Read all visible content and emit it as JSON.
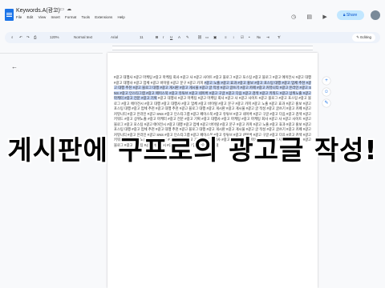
{
  "window": {
    "doc_title": "Keywords.A(광고)"
  },
  "menu": [
    "File",
    "Edit",
    "View",
    "Insert",
    "Format",
    "Tools",
    "Extensions",
    "Help"
  ],
  "header": {
    "share_label": "Share"
  },
  "toolbar": {
    "zoom": "120%",
    "style": "Normal text",
    "font": "Arial",
    "font_size": "11",
    "mode": "Editing"
  },
  "document": {
    "para_1": "#광고 대행사 #광고 마케팅 #광고 마케팅 회사 #광고 사 #광고 사이트 #광고 블로그 #광고 포스팅 #광고 블로그 #광고 에이전시 #광고 대행 #광고 대행사 #광고 업체 #광고 바이럴 #광고 문구 #광고 카피",
    "para_2": "#광고 노출 #광고 효과 #광고 홍보 #광고 포스팅 대행 #광고 업체 추천 #광고 대행 추천 #광고 블로그 대행 #광고 게시판 #광고 게시물 #광고 글 작성 #광고 글쓰기 #광고 카페 #광고 커뮤니티 #광고 온라인 #광고 SNS #광고 인스타그램 #광고 페이스북 #광고 유튜브 #광고 네이버 #광고 구글 #광고 다음 #광고 검색 #광고 키워드 #광고 상위노출 #광고 마케터 #광고 전문 #광고 기획",
    "para_3": "#광고 대행사 #광고 마케팅 #광고 마케팅 회사 #광고 사 #광고 사이트 #광고 블로그 #광고 포스팅 #광고 블로그 #광고 에이전시 #광고 대행 #광고 대행사 #광고 업체 #광고 바이럴 #광고 문구 #광고 카피 #광고 노출 #광고 효과 #광고 홍보 #광고 포스팅 대행 #광고 업체 추천 #광고 대행 추천 #광고 블로그 대행 #광고 게시판 #광고 게시물 #광고 글 작성 #광고 글쓰기 #광고 카페 #광고 커뮤니티 #광고 온라인 #광고 SNS #광고 인스타그램 #광고 페이스북 #광고 유튜브 #광고 네이버 #광고 구글 #광고 다음 #광고 검색 #광고 키워드 #광고 상위노출 #광고 마케터 #광고 전문 #광고 기획 #광고 대행사 #광고 마케팅 #광고 마케팅 회사 #광고 사 #광고 사이트 #광고 블로그 #광고 포스팅 #광고 에이전시 #광고 대행 #광고 업체 #광고 바이럴 #광고 문구 #광고 카피 #광고 노출 #광고 효과 #광고 홍보 #광고 포스팅 대행 #광고 업체 추천 #광고 대행 추천 #광고 블로그 대행 #광고 게시판 #광고 게시물 #광고 글 작성 #광고 글쓰기 #광고 카페 #광고 커뮤니티 #광고 온라인 #광고 SNS #광고 인스타그램 #광고 페이스북 #광고 유튜브 #광고 네이버 #광고 구글 #광고 다음 #광고 검색 #광고 키워드 #광고 상위노출 #광고 마케터 #광고 전문 #광고 기획 #광고 대행사 #광고 마케팅 #광고 마케팅 회사 #광고 사 #광고 사이트 #광고 블로그 #광고 포스팅 #광고 에이전시 #광고 대행 #광고 업체 #광고 바이럴"
  },
  "overlay": {
    "caption": "게시판에 구프로의 광고글 작성!"
  },
  "colors": {
    "accent": "#1a73e8",
    "selection": "#c8d8f7",
    "share_bg": "#c2e7ff"
  },
  "icons": [
    "docs-logo-icon",
    "star-icon",
    "move-icon",
    "cloud-icon",
    "history-icon",
    "comment-icon",
    "video-icon",
    "lock-icon",
    "avatar",
    "collapse-arrow-icon",
    "add-comment-icon",
    "emoji-icon",
    "suggest-icon"
  ]
}
